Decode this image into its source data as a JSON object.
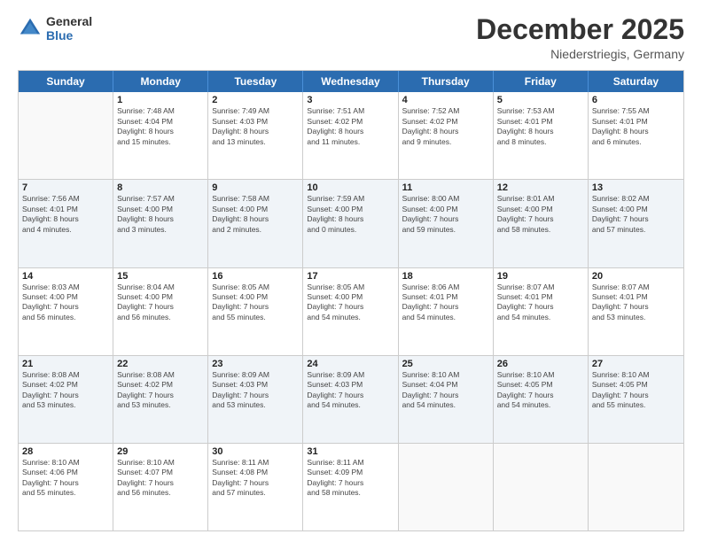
{
  "header": {
    "logo_line1": "General",
    "logo_line2": "Blue",
    "month": "December 2025",
    "location": "Niederstriegis, Germany"
  },
  "weekdays": [
    "Sunday",
    "Monday",
    "Tuesday",
    "Wednesday",
    "Thursday",
    "Friday",
    "Saturday"
  ],
  "rows": [
    {
      "alt": false,
      "cells": [
        {
          "day": "",
          "info": ""
        },
        {
          "day": "1",
          "info": "Sunrise: 7:48 AM\nSunset: 4:04 PM\nDaylight: 8 hours\nand 15 minutes."
        },
        {
          "day": "2",
          "info": "Sunrise: 7:49 AM\nSunset: 4:03 PM\nDaylight: 8 hours\nand 13 minutes."
        },
        {
          "day": "3",
          "info": "Sunrise: 7:51 AM\nSunset: 4:02 PM\nDaylight: 8 hours\nand 11 minutes."
        },
        {
          "day": "4",
          "info": "Sunrise: 7:52 AM\nSunset: 4:02 PM\nDaylight: 8 hours\nand 9 minutes."
        },
        {
          "day": "5",
          "info": "Sunrise: 7:53 AM\nSunset: 4:01 PM\nDaylight: 8 hours\nand 8 minutes."
        },
        {
          "day": "6",
          "info": "Sunrise: 7:55 AM\nSunset: 4:01 PM\nDaylight: 8 hours\nand 6 minutes."
        }
      ]
    },
    {
      "alt": true,
      "cells": [
        {
          "day": "7",
          "info": "Sunrise: 7:56 AM\nSunset: 4:01 PM\nDaylight: 8 hours\nand 4 minutes."
        },
        {
          "day": "8",
          "info": "Sunrise: 7:57 AM\nSunset: 4:00 PM\nDaylight: 8 hours\nand 3 minutes."
        },
        {
          "day": "9",
          "info": "Sunrise: 7:58 AM\nSunset: 4:00 PM\nDaylight: 8 hours\nand 2 minutes."
        },
        {
          "day": "10",
          "info": "Sunrise: 7:59 AM\nSunset: 4:00 PM\nDaylight: 8 hours\nand 0 minutes."
        },
        {
          "day": "11",
          "info": "Sunrise: 8:00 AM\nSunset: 4:00 PM\nDaylight: 7 hours\nand 59 minutes."
        },
        {
          "day": "12",
          "info": "Sunrise: 8:01 AM\nSunset: 4:00 PM\nDaylight: 7 hours\nand 58 minutes."
        },
        {
          "day": "13",
          "info": "Sunrise: 8:02 AM\nSunset: 4:00 PM\nDaylight: 7 hours\nand 57 minutes."
        }
      ]
    },
    {
      "alt": false,
      "cells": [
        {
          "day": "14",
          "info": "Sunrise: 8:03 AM\nSunset: 4:00 PM\nDaylight: 7 hours\nand 56 minutes."
        },
        {
          "day": "15",
          "info": "Sunrise: 8:04 AM\nSunset: 4:00 PM\nDaylight: 7 hours\nand 56 minutes."
        },
        {
          "day": "16",
          "info": "Sunrise: 8:05 AM\nSunset: 4:00 PM\nDaylight: 7 hours\nand 55 minutes."
        },
        {
          "day": "17",
          "info": "Sunrise: 8:05 AM\nSunset: 4:00 PM\nDaylight: 7 hours\nand 54 minutes."
        },
        {
          "day": "18",
          "info": "Sunrise: 8:06 AM\nSunset: 4:01 PM\nDaylight: 7 hours\nand 54 minutes."
        },
        {
          "day": "19",
          "info": "Sunrise: 8:07 AM\nSunset: 4:01 PM\nDaylight: 7 hours\nand 54 minutes."
        },
        {
          "day": "20",
          "info": "Sunrise: 8:07 AM\nSunset: 4:01 PM\nDaylight: 7 hours\nand 53 minutes."
        }
      ]
    },
    {
      "alt": true,
      "cells": [
        {
          "day": "21",
          "info": "Sunrise: 8:08 AM\nSunset: 4:02 PM\nDaylight: 7 hours\nand 53 minutes."
        },
        {
          "day": "22",
          "info": "Sunrise: 8:08 AM\nSunset: 4:02 PM\nDaylight: 7 hours\nand 53 minutes."
        },
        {
          "day": "23",
          "info": "Sunrise: 8:09 AM\nSunset: 4:03 PM\nDaylight: 7 hours\nand 53 minutes."
        },
        {
          "day": "24",
          "info": "Sunrise: 8:09 AM\nSunset: 4:03 PM\nDaylight: 7 hours\nand 54 minutes."
        },
        {
          "day": "25",
          "info": "Sunrise: 8:10 AM\nSunset: 4:04 PM\nDaylight: 7 hours\nand 54 minutes."
        },
        {
          "day": "26",
          "info": "Sunrise: 8:10 AM\nSunset: 4:05 PM\nDaylight: 7 hours\nand 54 minutes."
        },
        {
          "day": "27",
          "info": "Sunrise: 8:10 AM\nSunset: 4:05 PM\nDaylight: 7 hours\nand 55 minutes."
        }
      ]
    },
    {
      "alt": false,
      "cells": [
        {
          "day": "28",
          "info": "Sunrise: 8:10 AM\nSunset: 4:06 PM\nDaylight: 7 hours\nand 55 minutes."
        },
        {
          "day": "29",
          "info": "Sunrise: 8:10 AM\nSunset: 4:07 PM\nDaylight: 7 hours\nand 56 minutes."
        },
        {
          "day": "30",
          "info": "Sunrise: 8:11 AM\nSunset: 4:08 PM\nDaylight: 7 hours\nand 57 minutes."
        },
        {
          "day": "31",
          "info": "Sunrise: 8:11 AM\nSunset: 4:09 PM\nDaylight: 7 hours\nand 58 minutes."
        },
        {
          "day": "",
          "info": ""
        },
        {
          "day": "",
          "info": ""
        },
        {
          "day": "",
          "info": ""
        }
      ]
    }
  ]
}
